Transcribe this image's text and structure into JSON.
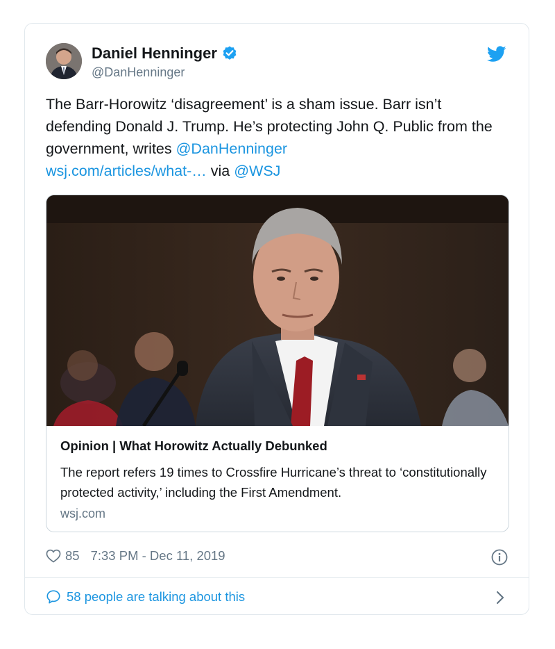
{
  "tweet": {
    "author_name": "Daniel Henninger",
    "author_handle": "@DanHenninger",
    "text_1": "The Barr-Horowitz ‘disagreement’ is a sham issue. Barr isn’t defending Donald J. Trump. He’s protecting John Q. Public from the government, writes ",
    "mention_author": "@DanHenninger",
    "link_text": "wsj.com/articles/what-…",
    "via_text": " via ",
    "mention_wsj": "@WSJ"
  },
  "link_card": {
    "title": "Opinion | What Horowitz Actually Debunked",
    "description": "The report refers 19 times to Crossfire Hurricane’s threat to ‘constitutionally protected activity,’ including the First Amendment.",
    "domain": "wsj.com"
  },
  "meta": {
    "likes": "85",
    "timestamp": "7:33 PM - Dec 11, 2019"
  },
  "footer": {
    "talking": "58 people are talking about this"
  },
  "colors": {
    "link_blue": "#1b95e0",
    "muted_gray": "#657786",
    "border": "#e1e8ed"
  },
  "icons": [
    "verified-badge-icon",
    "twitter-bird-icon",
    "heart-icon",
    "info-icon",
    "speech-bubble-icon",
    "chevron-right-icon"
  ]
}
